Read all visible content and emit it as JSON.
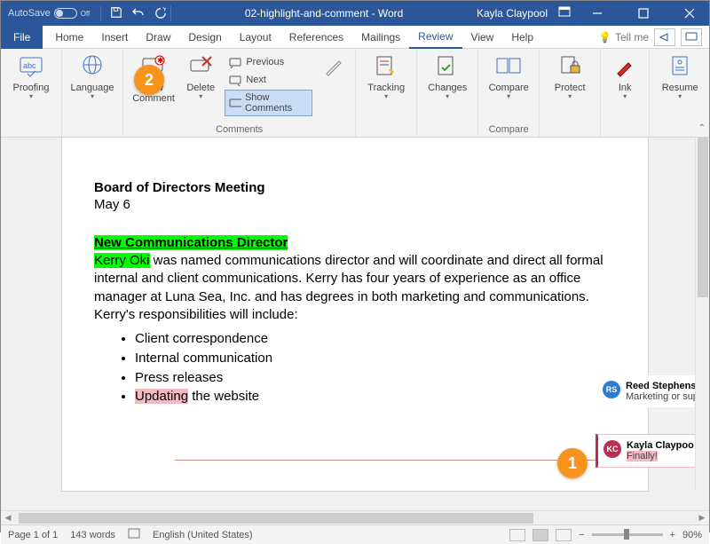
{
  "titlebar": {
    "autosave_label": "AutoSave",
    "autosave_state": "Off",
    "title_doc": "02-highlight-and-comment - Word",
    "user": "Kayla Claypool"
  },
  "tabs": {
    "file": "File",
    "items": [
      "Home",
      "Insert",
      "Draw",
      "Design",
      "Layout",
      "References",
      "Mailings",
      "Review",
      "View",
      "Help"
    ],
    "active_index": 7,
    "tell_me": "Tell me"
  },
  "ribbon": {
    "proofing": {
      "label": "Proofing",
      "btn": "Proofing"
    },
    "language": {
      "label": "Language",
      "btn": "Language"
    },
    "comments": {
      "label": "Comments",
      "new_comment": "New Comment",
      "delete": "Delete",
      "previous": "Previous",
      "next": "Next",
      "show": "Show Comments"
    },
    "tracking": {
      "label": "Tracking",
      "btn": "Tracking"
    },
    "changes": {
      "label": "Changes",
      "btn": "Changes"
    },
    "compare": {
      "label": "Compare",
      "btn": "Compare"
    },
    "protect": {
      "label": "Protect",
      "btn": "Protect"
    },
    "ink": {
      "label": "Ink",
      "btn": "Ink"
    },
    "resume": {
      "label": "Resume",
      "btn": "Resume"
    }
  },
  "document": {
    "heading": "Board of Directors Meeting",
    "date": "May 6",
    "subheading": "New Communications Director",
    "highlighted_name": "Kerry Oki",
    "para_rest": " was named communications director and will coordinate and direct all formal internal and client communications. Kerry has four years of experience as an office manager at Luna Sea, Inc. and has degrees in both marketing and communications. Kerry's responsibilities will include:",
    "bullets": [
      "Client correspondence",
      "Internal communication",
      "Press releases"
    ],
    "bullet_highlighted": "Updating",
    "bullet_rest": " the website"
  },
  "comments_pane": {
    "comment1": {
      "initials": "RS",
      "name": "Reed Stephens",
      "text": "Marketing or sup"
    },
    "comment2": {
      "initials": "KC",
      "name": "Kayla Claypoo",
      "text": "Finally!"
    }
  },
  "callouts": {
    "one": "1",
    "two": "2"
  },
  "statusbar": {
    "page": "Page 1 of 1",
    "words": "143 words",
    "lang": "English (United States)",
    "zoom": "90%"
  }
}
